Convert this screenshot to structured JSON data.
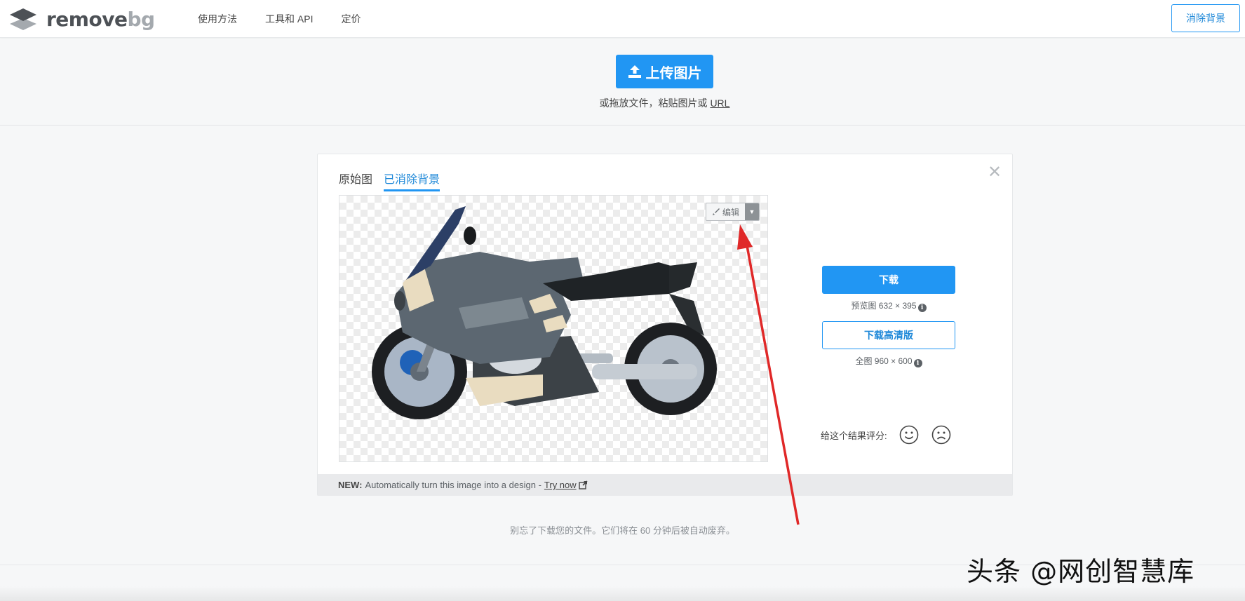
{
  "header": {
    "logo_remove": "remove",
    "logo_bg": "bg",
    "nav": [
      "使用方法",
      "工具和 API",
      "定价"
    ],
    "cta_label": "消除背景"
  },
  "upload": {
    "button_label": "上传图片",
    "hint_prefix": "或拖放文件，粘贴图片或",
    "hint_link": "URL"
  },
  "result": {
    "tabs": [
      {
        "label": "原始图",
        "active": false
      },
      {
        "label": "已消除背景",
        "active": true
      }
    ],
    "edit_label": "编辑",
    "download_label": "下载",
    "preview_note": "预览图 632 × 395",
    "download_hd_label": "下载高清版",
    "full_note": "全图 960 × 600",
    "rating_label": "给这个结果评分:",
    "footer_new": "NEW:",
    "footer_text": "Automatically turn this image into a design -",
    "footer_link": "Try now"
  },
  "expire_note": "别忘了下载您的文件。它们将在 60 分钟后被自动废弃。",
  "watermark": "头条 @网创智慧库",
  "colors": {
    "accent": "#2196f3",
    "arrow": "#e02828"
  }
}
